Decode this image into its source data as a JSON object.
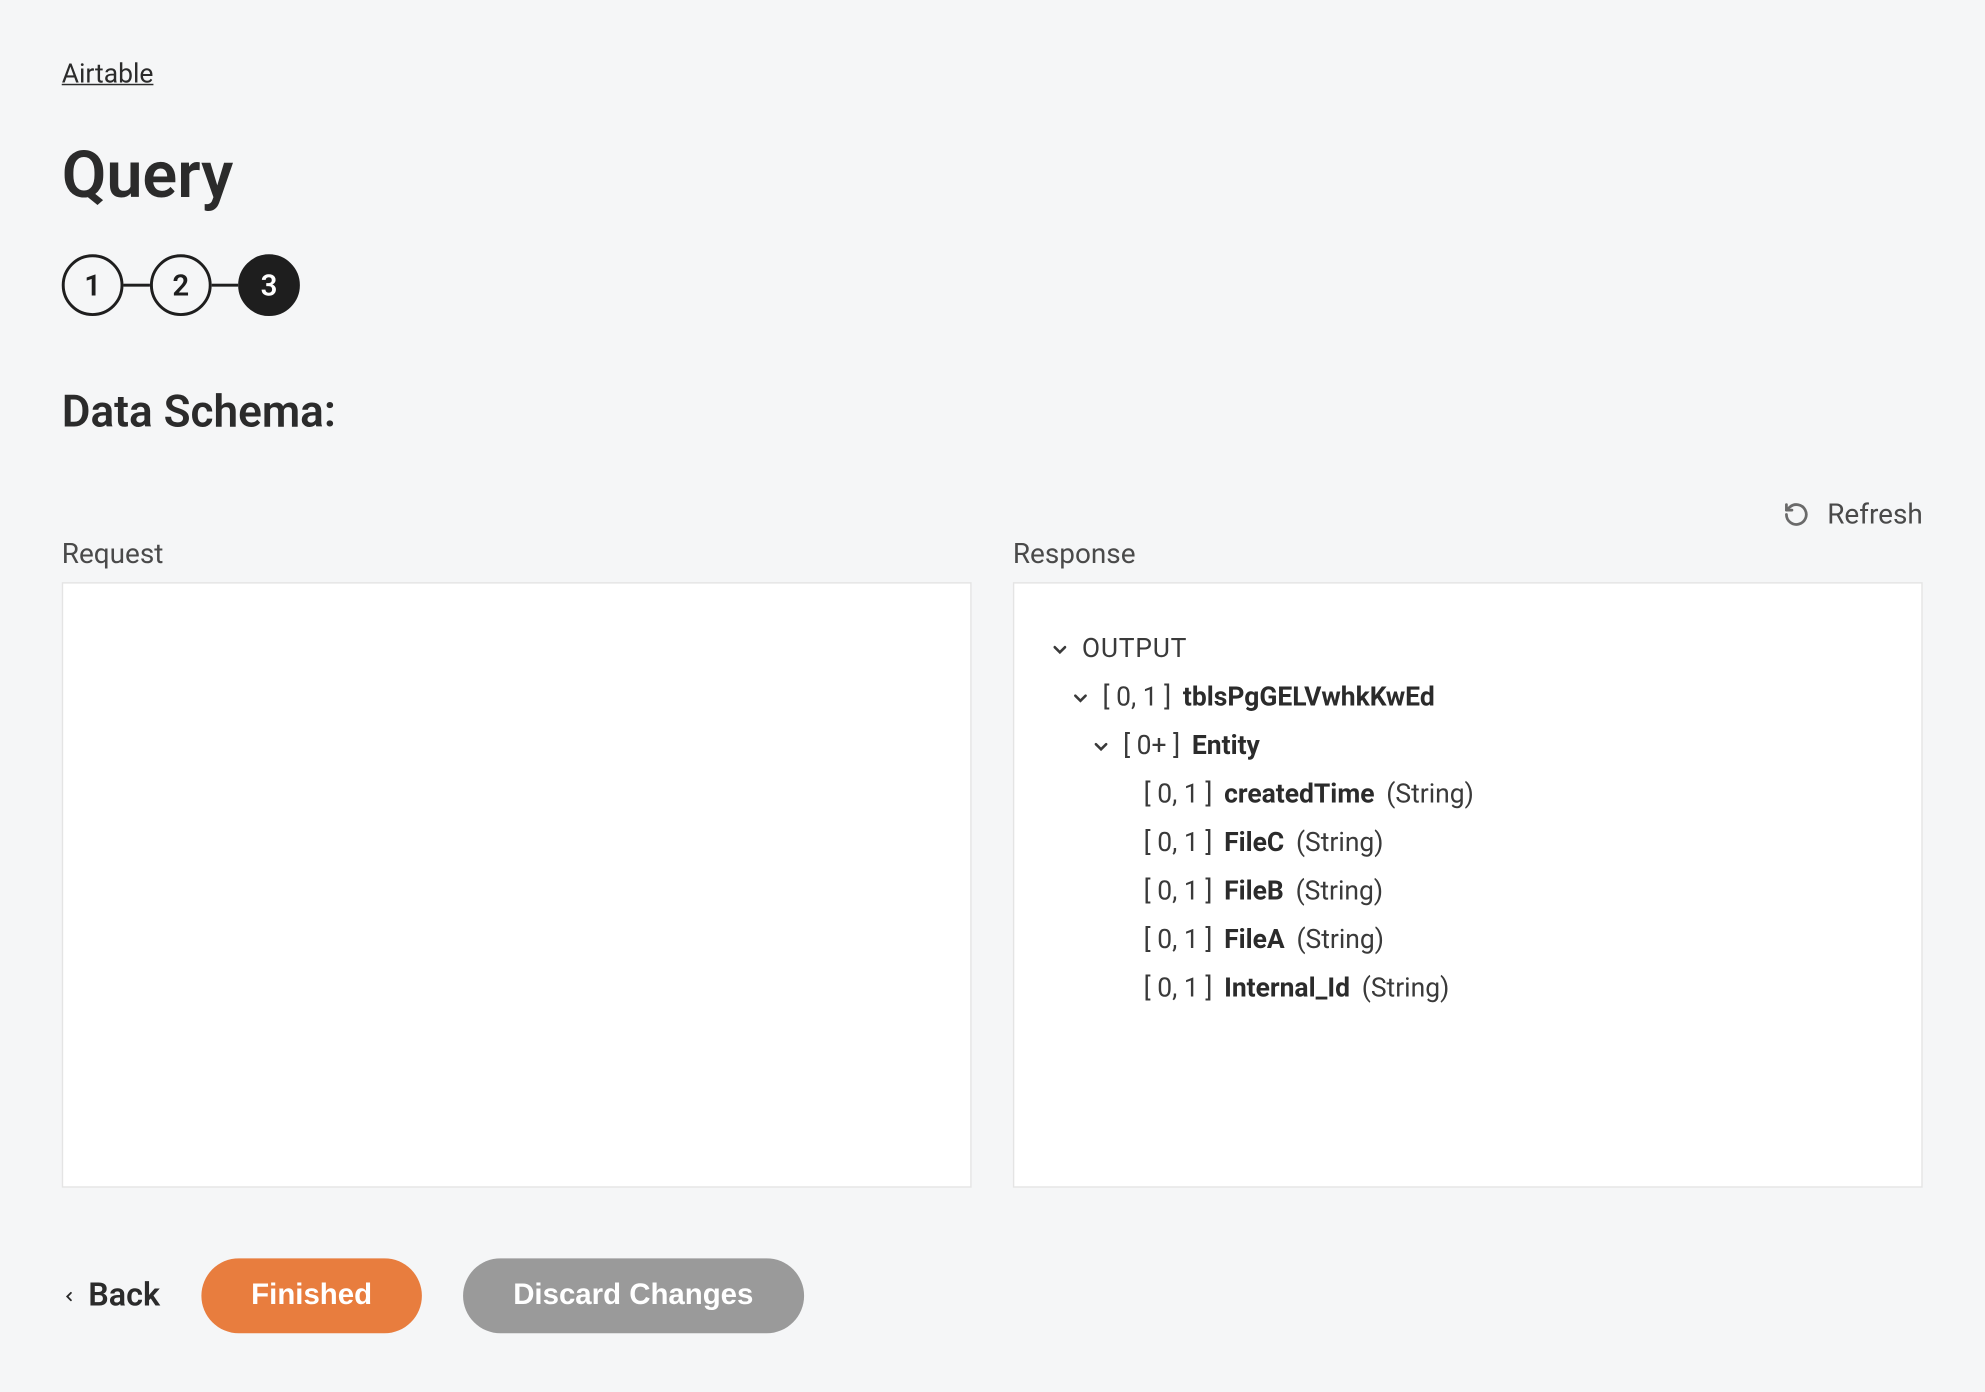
{
  "breadcrumb": "Airtable",
  "page_title": "Query",
  "stepper": {
    "steps": [
      "1",
      "2",
      "3"
    ],
    "active_index": 2
  },
  "section_title": "Data Schema:",
  "refresh_label": "Refresh",
  "panels": {
    "request": {
      "label": "Request"
    },
    "response": {
      "label": "Response",
      "tree": {
        "root_label": "OUTPUT",
        "node1": {
          "cardinality": "[ 0, 1 ]",
          "name": "tblsPgGELVwhkKwEd"
        },
        "node2": {
          "cardinality": "[ 0+ ]",
          "name": "Entity"
        },
        "fields": [
          {
            "cardinality": "[ 0, 1 ]",
            "name": "createdTime",
            "type": "(String)"
          },
          {
            "cardinality": "[ 0, 1 ]",
            "name": "FileC",
            "type": "(String)"
          },
          {
            "cardinality": "[ 0, 1 ]",
            "name": "FileB",
            "type": "(String)"
          },
          {
            "cardinality": "[ 0, 1 ]",
            "name": "FileA",
            "type": "(String)"
          },
          {
            "cardinality": "[ 0, 1 ]",
            "name": "Internal_Id",
            "type": "(String)"
          }
        ]
      }
    }
  },
  "footer": {
    "back_label": "Back",
    "finished_label": "Finished",
    "discard_label": "Discard Changes"
  }
}
